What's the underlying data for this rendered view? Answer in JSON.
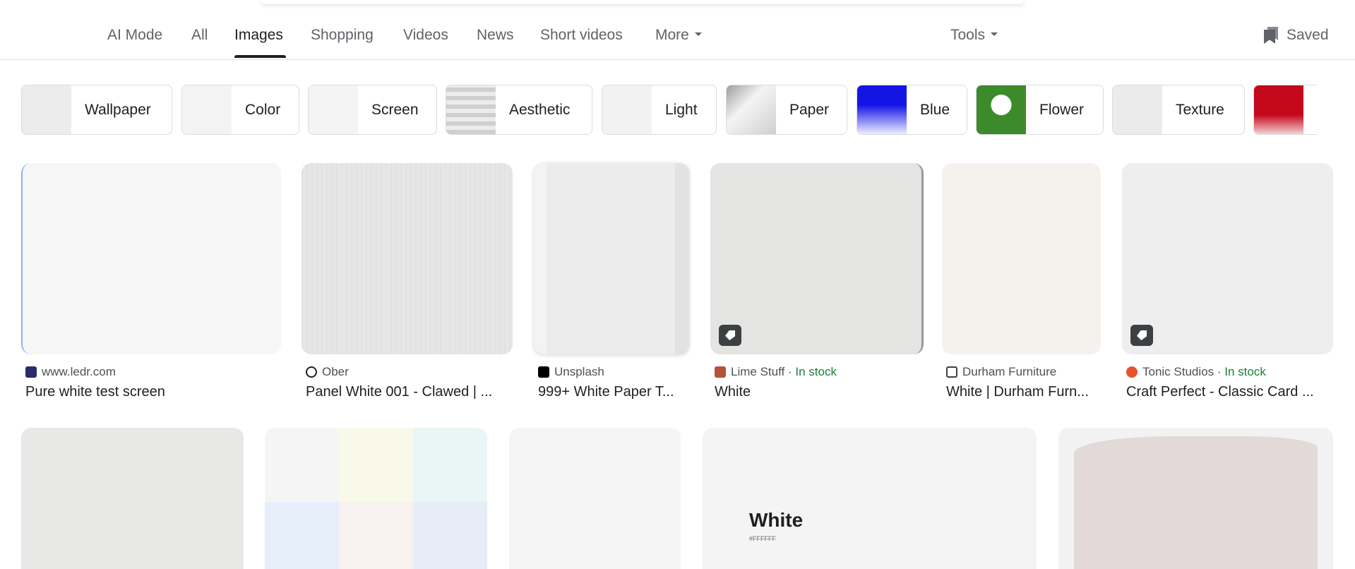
{
  "nav": {
    "tabs": [
      {
        "label": "AI Mode"
      },
      {
        "label": "All"
      },
      {
        "label": "Images"
      },
      {
        "label": "Shopping"
      },
      {
        "label": "Videos"
      },
      {
        "label": "News"
      },
      {
        "label": "Short videos"
      },
      {
        "label": "More"
      }
    ],
    "active_tab": "Images",
    "tools_label": "Tools",
    "saved_label": "Saved"
  },
  "chips": [
    {
      "label": "Wallpaper",
      "thumb_color": "#ececec"
    },
    {
      "label": "Color",
      "thumb_color": "#f3f3f3"
    },
    {
      "label": "Screen",
      "thumb_color": "#f4f4f4"
    },
    {
      "label": "Aesthetic",
      "thumb_color": "#d9d9d9"
    },
    {
      "label": "Light",
      "thumb_color": "#f2f2f2"
    },
    {
      "label": "Paper",
      "thumb_color": "#bdbdbd"
    },
    {
      "label": "Blue",
      "thumb_color": "#1414e6"
    },
    {
      "label": "Flower",
      "thumb_color": "#3d8a2a"
    },
    {
      "label": "Texture",
      "thumb_color": "#ebebeb"
    },
    {
      "label": "",
      "thumb_color": "#c4081c"
    }
  ],
  "results": [
    {
      "source": "www.ledr.com",
      "title": "Pure white test screen",
      "in_stock": "",
      "favicon": "#2b2b6b",
      "color": "#f6f6f6"
    },
    {
      "source": "Ober",
      "title": "Panel White 001 - Clawed | ...",
      "in_stock": "",
      "favicon": "#1f1f1f",
      "color": "#e6e6e6"
    },
    {
      "source": "Unsplash",
      "title": "999+ White Paper T...",
      "in_stock": "",
      "favicon": "#000000",
      "color": "#ececec"
    },
    {
      "source": "Lime Stuff",
      "title": "White",
      "in_stock": "In stock",
      "favicon": "#b5523b",
      "color": "#e4e5e2"
    },
    {
      "source": "Durham Furniture",
      "title": "White | Durham Furn...",
      "in_stock": "",
      "favicon": "#3c4043",
      "color": "#f5f2ee"
    },
    {
      "source": "Tonic Studios",
      "title": "Craft Perfect - Classic Card ...",
      "in_stock": "In stock",
      "favicon": "#e8532b",
      "color": "#eeeeef"
    }
  ],
  "bottom_row": [
    {
      "color": "#e8e8e6"
    },
    {
      "color": "#f3f3f3"
    },
    {
      "color": "#f5f5f5"
    },
    {
      "color": "#f4f4f4",
      "swatch_title": "White",
      "swatch_sub": "#FFFFFF"
    },
    {
      "color": "#f2f2f2"
    }
  ],
  "separator": "·"
}
